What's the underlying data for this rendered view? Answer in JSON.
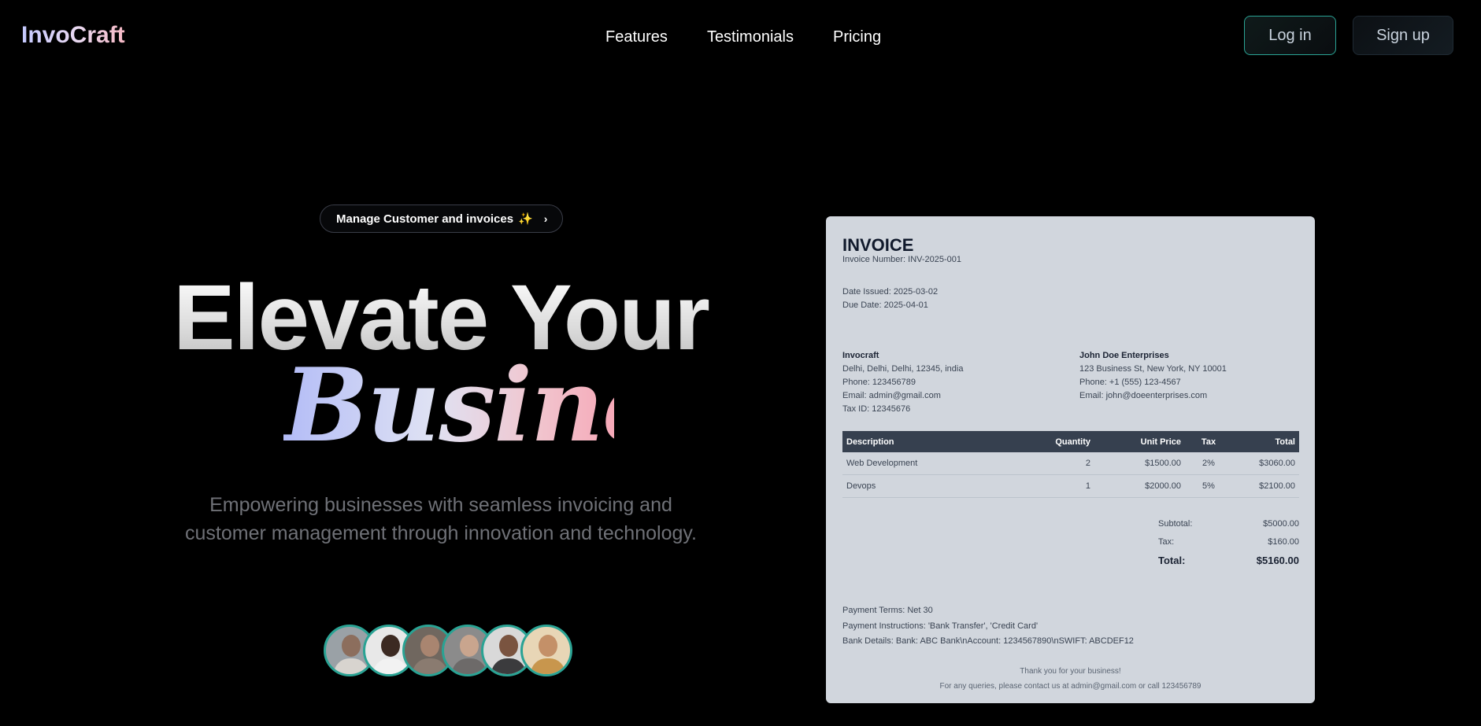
{
  "brand": "InvoCraft",
  "nav": {
    "links": [
      "Features",
      "Testimonials",
      "Pricing"
    ],
    "login": "Log in",
    "signup": "Sign up"
  },
  "hero": {
    "pill": "Manage Customer and invoices",
    "pill_emoji": "✨",
    "title_line1": "Elevate Your",
    "title_line2": "Business",
    "subtitle_line1": "Empowering businesses with seamless invoicing and",
    "subtitle_line2": "customer management through innovation and technology."
  },
  "avatars": [
    {
      "skin": "#8c6e5d",
      "shirt": "#d8d4cf",
      "bg": "#9aa1a6"
    },
    {
      "skin": "#3c2a22",
      "shirt": "#f2f2f2",
      "bg": "#e8e8e8"
    },
    {
      "skin": "#a98570",
      "shirt": "#8a7b70",
      "bg": "#70675f"
    },
    {
      "skin": "#c9a58e",
      "shirt": "#6d6a69",
      "bg": "#8b8b8b"
    },
    {
      "skin": "#7a5440",
      "shirt": "#3b3b3d",
      "bg": "#d9d9d9"
    },
    {
      "skin": "#c49068",
      "shirt": "#c8964d",
      "bg": "#e8d6b6"
    }
  ],
  "invoice": {
    "title": "INVOICE",
    "number": "Invoice Number: INV-2025-001",
    "date_issued": "Date Issued: 2025-03-02",
    "due_date": "Due Date: 2025-04-01",
    "from": {
      "name": "Invocraft",
      "address": "Delhi, Delhi, Delhi, 12345, india",
      "phone": "Phone: 123456789",
      "email": "Email: admin@gmail.com",
      "tax": "Tax ID: 12345676"
    },
    "to": {
      "name": "John Doe Enterprises",
      "address": "123 Business St, New York, NY 10001",
      "phone": "Phone: +1 (555) 123-4567",
      "email": "Email: john@doeenterprises.com"
    },
    "headers": [
      "Description",
      "Quantity",
      "Unit Price",
      "Tax",
      "Total"
    ],
    "rows": [
      [
        "Web Development",
        "2",
        "$1500.00",
        "2%",
        "$3060.00"
      ],
      [
        "Devops",
        "1",
        "$2000.00",
        "5%",
        "$2100.00"
      ]
    ],
    "subtotal_label": "Subtotal:",
    "subtotal": "$5000.00",
    "tax_label": "Tax:",
    "tax": "$160.00",
    "total_label": "Total:",
    "total": "$5160.00",
    "terms": "Payment Terms: Net 30",
    "instructions": "Payment Instructions: 'Bank Transfer', 'Credit Card'",
    "bank": "Bank Details: Bank: ABC Bank\\nAccount: 1234567890\\nSWIFT: ABCDEF12",
    "thanks": "Thank you for your business!",
    "contact": "For any queries, please contact us at admin@gmail.com or call 123456789"
  }
}
